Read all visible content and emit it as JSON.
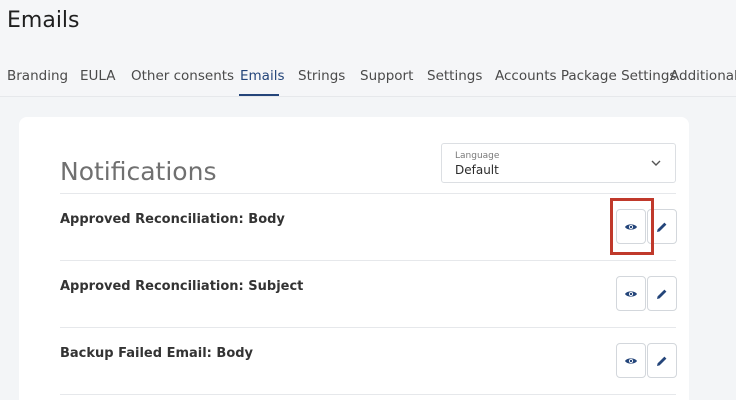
{
  "page": {
    "title": "Emails"
  },
  "tabs": [
    {
      "label": "Branding"
    },
    {
      "label": "EULA"
    },
    {
      "label": "Other consents"
    },
    {
      "label": "Emails",
      "active": true
    },
    {
      "label": "Strings"
    },
    {
      "label": "Support"
    },
    {
      "label": "Settings"
    },
    {
      "label": "Accounts Package Settings"
    },
    {
      "label": "Additional U"
    }
  ],
  "card": {
    "title": "Notifications",
    "language": {
      "label": "Language",
      "value": "Default"
    }
  },
  "rows": [
    {
      "label": "Approved Reconciliation: Body"
    },
    {
      "label": "Approved Reconciliation: Subject"
    },
    {
      "label": "Backup Failed Email: Body"
    }
  ],
  "icons": {
    "preview": "eye-icon",
    "edit": "pencil-icon",
    "dropdown": "chevron-down-icon"
  },
  "colors": {
    "accent": "#24457a",
    "highlight": "#c0392b"
  }
}
